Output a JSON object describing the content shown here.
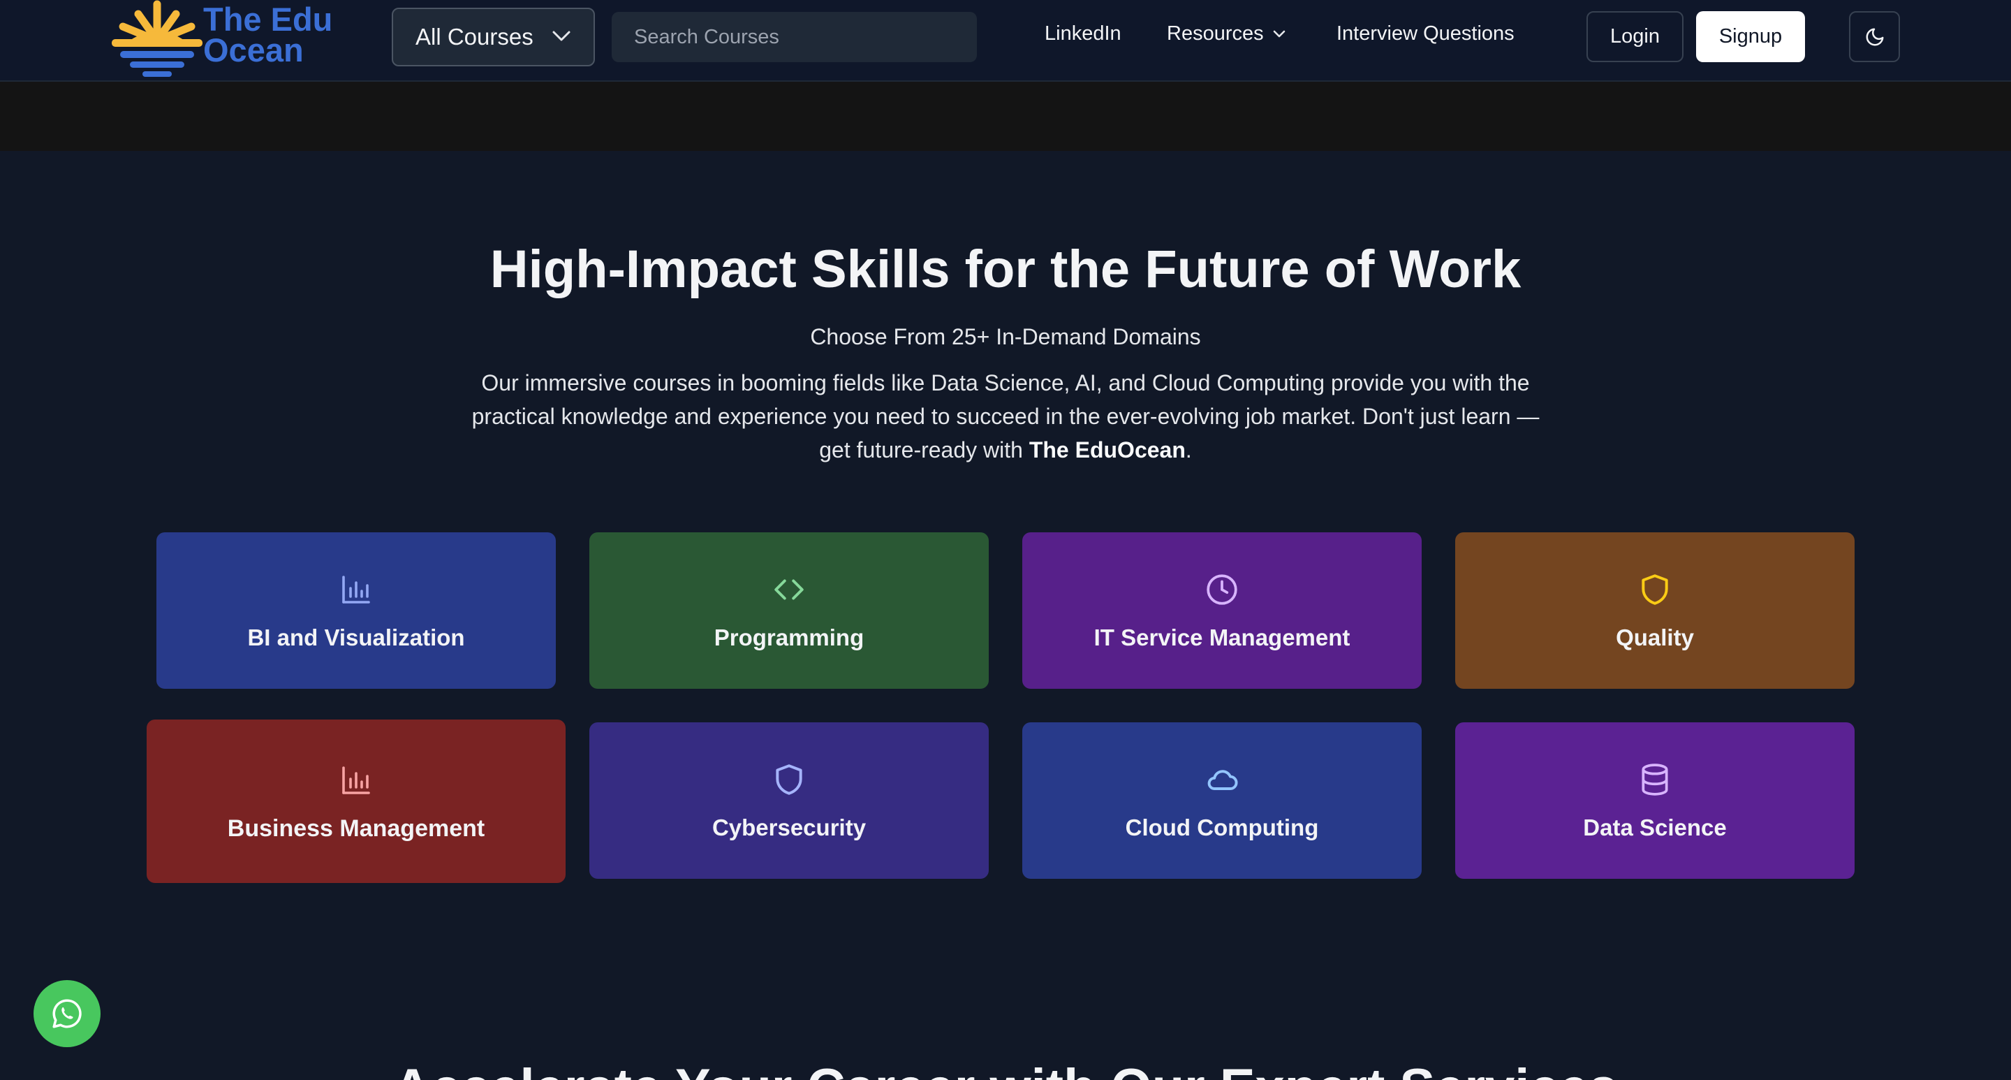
{
  "brand": {
    "line1": "The Edu",
    "line2": "Ocean"
  },
  "nav": {
    "courses_dropdown": "All Courses",
    "search_placeholder": "Search Courses",
    "links": {
      "linkedin": "LinkedIn",
      "resources": "Resources",
      "interview": "Interview Questions"
    },
    "login": "Login",
    "signup": "Signup"
  },
  "hero": {
    "title": "High-Impact Skills for the Future of Work",
    "subtitle": "Choose From 25+ In-Demand Domains",
    "desc_part1": "Our immersive courses in booming fields like Data Science, AI, and Cloud Computing provide you with the practical knowledge and experience you need to succeed in the ever-evolving job market. Don't just learn — get future-ready with ",
    "desc_bold": "The EduOcean",
    "desc_end": "."
  },
  "categories": [
    {
      "label": "BI and Visualization",
      "icon": "bar-chart-icon",
      "color": "#283a8a",
      "icon_color": "#93a8f4"
    },
    {
      "label": "Programming",
      "icon": "code-icon",
      "color": "#2a5834",
      "icon_color": "#86d99a"
    },
    {
      "label": "IT Service Management",
      "icon": "clock-icon",
      "color": "#57208a",
      "icon_color": "#d8b4fe"
    },
    {
      "label": "Quality",
      "icon": "shield-icon",
      "color": "#744520",
      "icon_color": "#facc15"
    },
    {
      "label": "Business Management",
      "icon": "bar-chart-icon",
      "color": "#7a2323",
      "icon_color": "#f8a3a3"
    },
    {
      "label": "Cybersecurity",
      "icon": "shield-icon",
      "color": "#362c82",
      "icon_color": "#a5b4fc"
    },
    {
      "label": "Cloud Computing",
      "icon": "cloud-icon",
      "color": "#283a8a",
      "icon_color": "#93c5fd"
    },
    {
      "label": "Data Science",
      "icon": "database-icon",
      "color": "#5b2293",
      "icon_color": "#d8b4fe"
    }
  ],
  "section2": {
    "title": "Accelerate Your Career with Our Expert Services"
  },
  "colors": {
    "logo_blue": "#3b6fd6",
    "logo_sun": "#f6b93b",
    "whatsapp": "#48c75e"
  }
}
